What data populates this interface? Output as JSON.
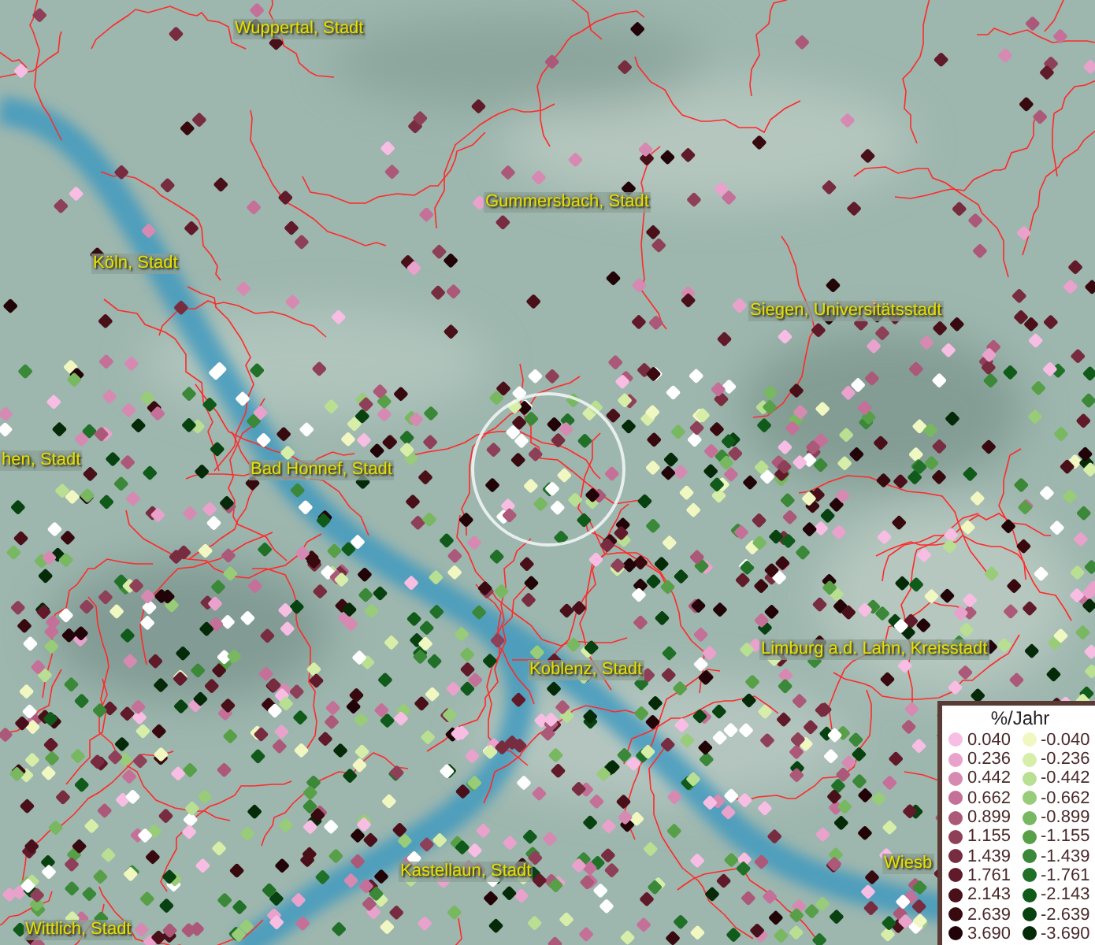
{
  "map": {
    "places": [
      {
        "name": "Wuppertal, Stadt"
      },
      {
        "name": "Gummersbach, Stadt"
      },
      {
        "name": "Köln, Stadt"
      },
      {
        "name": "Siegen, Universitätsstadt"
      },
      {
        "name": "hen, Stadt"
      },
      {
        "name": "Bad Honnef, Stadt"
      },
      {
        "name": "Limburg a.d. Lahn, Kreisstadt"
      },
      {
        "name": "Koblenz, Stadt"
      },
      {
        "name": "Wiesb"
      },
      {
        "name": "Kastellaun, Stadt"
      },
      {
        "name": "Wittlich, Stadt"
      }
    ]
  },
  "legend": {
    "title": "%/Jahr",
    "items": [
      {
        "label": "0.040",
        "color": "#f7bde3"
      },
      {
        "label": "-0.040",
        "color": "#f0f7c0"
      },
      {
        "label": "0.236",
        "color": "#e8a2cc"
      },
      {
        "label": "-0.236",
        "color": "#d6eea8"
      },
      {
        "label": "0.442",
        "color": "#d68ab2"
      },
      {
        "label": "-0.442",
        "color": "#b8df92"
      },
      {
        "label": "0.662",
        "color": "#c47098"
      },
      {
        "label": "-0.662",
        "color": "#98cc78"
      },
      {
        "label": "0.899",
        "color": "#ac5878"
      },
      {
        "label": "-0.899",
        "color": "#78b860"
      },
      {
        "label": "1.155",
        "color": "#8e4058"
      },
      {
        "label": "-1.155",
        "color": "#58a048"
      },
      {
        "label": "1.439",
        "color": "#782c40"
      },
      {
        "label": "-1.439",
        "color": "#3a8838"
      },
      {
        "label": "1.761",
        "color": "#601a2a"
      },
      {
        "label": "-1.761",
        "color": "#207028"
      },
      {
        "label": "2.143",
        "color": "#4a101a"
      },
      {
        "label": "-2.143",
        "color": "#105a1a"
      },
      {
        "label": "2.639",
        "color": "#380a10"
      },
      {
        "label": "-2.639",
        "color": "#084210"
      },
      {
        "label": "3.690",
        "color": "#220408"
      },
      {
        "label": "-3.690",
        "color": "#042a08"
      }
    ]
  }
}
